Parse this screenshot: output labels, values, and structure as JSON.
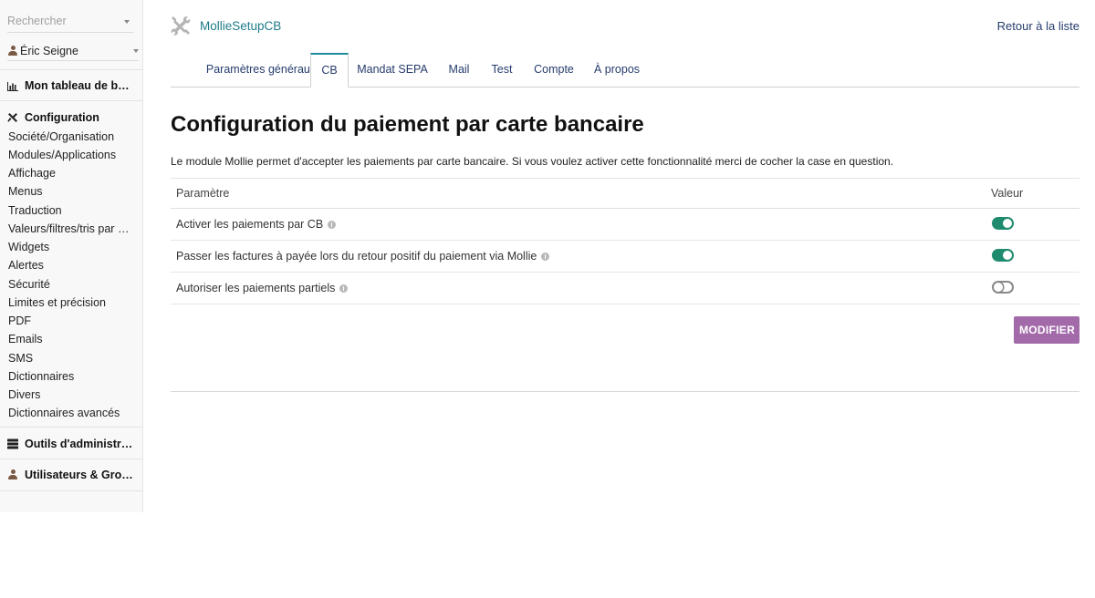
{
  "sidebar": {
    "search": {
      "placeholder": "Rechercher"
    },
    "user": {
      "name": "Éric Seigne"
    },
    "dashboard": {
      "label": "Mon tableau de bord",
      "icon": "chart-icon"
    },
    "configuration": {
      "label": "Configuration",
      "icon": "tools-icon",
      "items": [
        "Société/Organisation",
        "Modules/Applications",
        "Affichage",
        "Menus",
        "Traduction",
        "Valeurs/filtres/tris par défaut",
        "Widgets",
        "Alertes",
        "Sécurité",
        "Limites et précision",
        "PDF",
        "Emails",
        "SMS",
        "Dictionnaires",
        "Divers",
        "Dictionnaires avancés"
      ]
    },
    "admin_tools": {
      "label": "Outils d'administration",
      "icon": "server-icon"
    },
    "users_groups": {
      "label": "Utilisateurs & Groupes",
      "icon": "user-icon"
    }
  },
  "header": {
    "module_title": "MollieSetupCB",
    "back_link": "Retour à la liste"
  },
  "tabs": [
    {
      "label": "Paramètres généraux",
      "active": false
    },
    {
      "label": "CB",
      "active": true
    },
    {
      "label": "Mandat SEPA",
      "active": false
    },
    {
      "label": "Mail",
      "active": false
    },
    {
      "label": "Test",
      "active": false
    },
    {
      "label": "Compte",
      "active": false
    },
    {
      "label": "À propos",
      "active": false
    }
  ],
  "page": {
    "title": "Configuration du paiement par carte bancaire",
    "description": "Le module Mollie permet d'accepter les paiements par carte bancaire. Si vous voulez activer cette fonctionnalité merci de cocher la case en question."
  },
  "table": {
    "col_param": "Paramètre",
    "col_value": "Valeur",
    "rows": [
      {
        "label": "Activer les paiements par CB",
        "enabled": true
      },
      {
        "label": "Passer les factures à payée lors du retour positif du paiement via Mollie",
        "enabled": true
      },
      {
        "label": "Autoriser les paiements partiels",
        "enabled": false
      }
    ]
  },
  "actions": {
    "modify_label": "MODIFIER"
  },
  "colors": {
    "accent_teal": "#1e8c99",
    "toggle_on": "#1e8a6e",
    "button_purple": "#a26aa9",
    "link_navy": "#263c6c"
  }
}
